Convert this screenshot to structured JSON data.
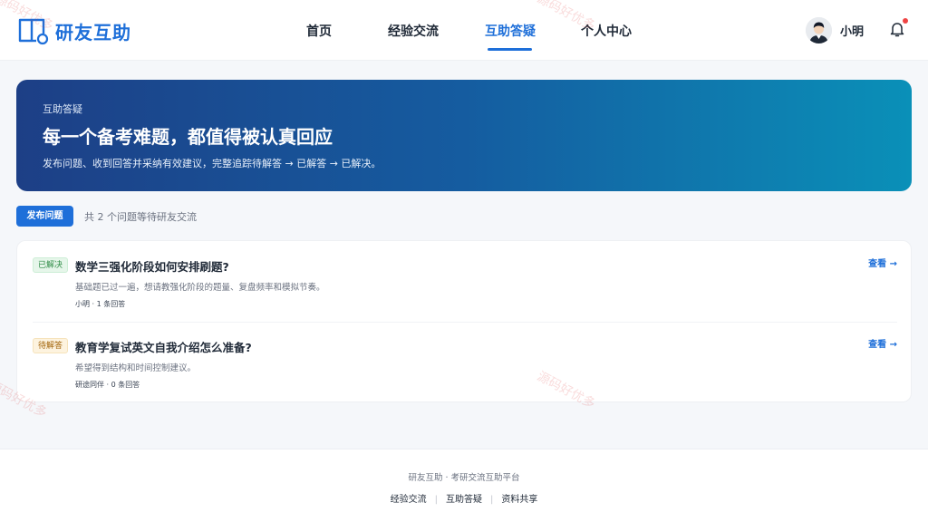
{
  "brand": {
    "name": "研友互助",
    "accent": "#1e6fd9"
  },
  "nav": {
    "items": [
      {
        "label": "首页",
        "active": false
      },
      {
        "label": "经验交流",
        "active": false
      },
      {
        "label": "互助答疑",
        "active": true
      },
      {
        "label": "个人中心",
        "active": false
      }
    ]
  },
  "user": {
    "name": "小明",
    "has_notification": true
  },
  "hero": {
    "kicker": "互助答疑",
    "title": "每一个备考难题，都值得被认真回应",
    "description": "发布问题、收到回答并采纳有效建议，完整追踪待解答 → 已解答 → 已解决。"
  },
  "actions": {
    "post_button": "发布问题",
    "count_text": "共 2 个问题等待研友交流"
  },
  "questions": [
    {
      "status": "已解决",
      "title": "数学三强化阶段如何安排刷题?",
      "description": "基础题已过一遍，想请教强化阶段的题量、复盘频率和模拟节奏。",
      "meta": "小明 · 1 条回答",
      "view_label": "查看 →"
    },
    {
      "status": "待解答",
      "title": "教育学复试英文自我介绍怎么准备?",
      "description": "希望得到结构和时间控制建议。",
      "meta": "研途同伴 · 0 条回答",
      "view_label": "查看 →"
    }
  ],
  "footer": {
    "brand_line": "研友互助 · 考研交流互助平台",
    "links": [
      "经验交流",
      "互助答疑",
      "资料共享"
    ]
  },
  "watermark": "源码好优多"
}
